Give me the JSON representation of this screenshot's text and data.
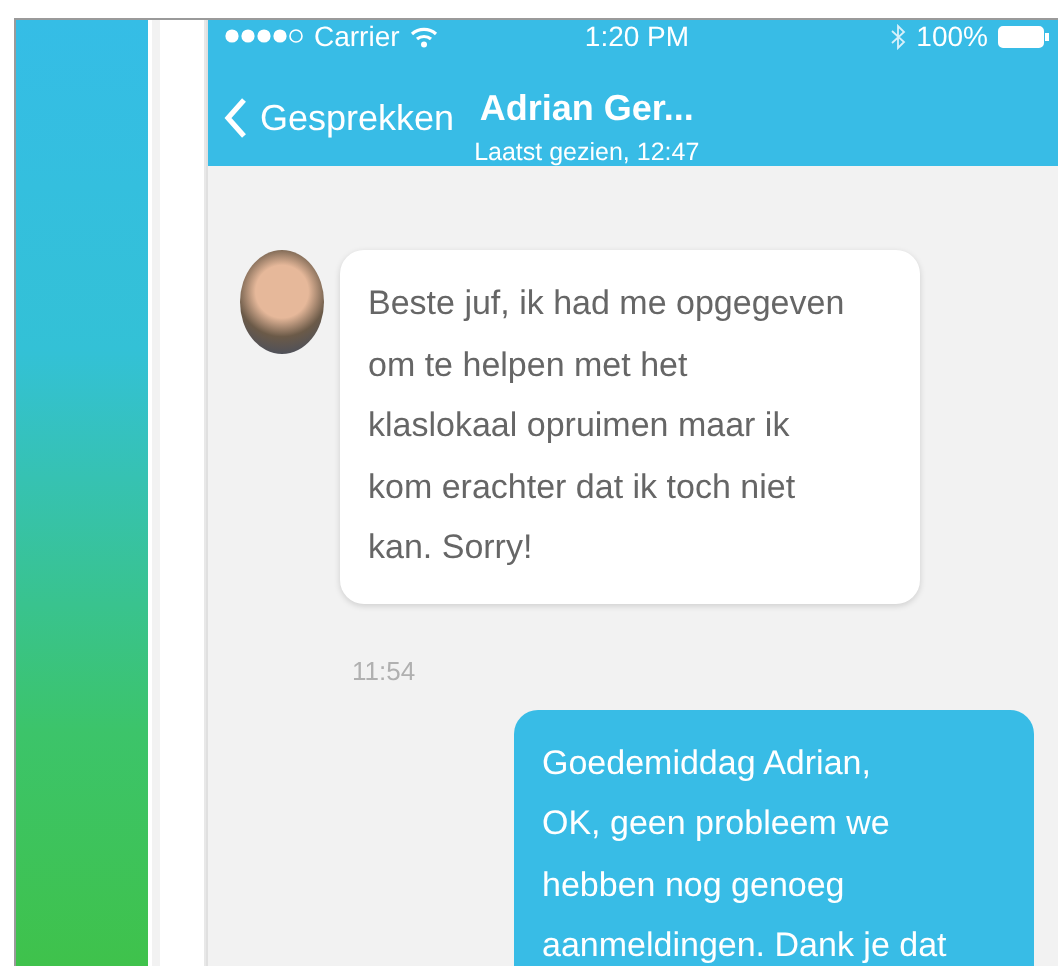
{
  "status_bar": {
    "carrier": "Carrier",
    "time": "1:20 PM",
    "battery": "100%"
  },
  "nav_bar": {
    "back": "Gesprekken",
    "title": "Adrian Ger...",
    "subtitle": "Laatst gezien, 12:47"
  },
  "messages": [
    {
      "kind": "incoming",
      "lines": [
        "Beste juf, ik had me opgegeven",
        "om te helpen met het",
        "klaslokaal opruimen maar ik",
        "kom erachter dat ik toch niet",
        "kan. Sorry!"
      ],
      "time": "11:54"
    },
    {
      "kind": "outgoing",
      "lines": [
        "Goedemiddag Adrian,",
        "OK, geen probleem we",
        "hebben nog genoeg",
        "aanmeldingen. Dank je dat"
      ]
    }
  ]
}
